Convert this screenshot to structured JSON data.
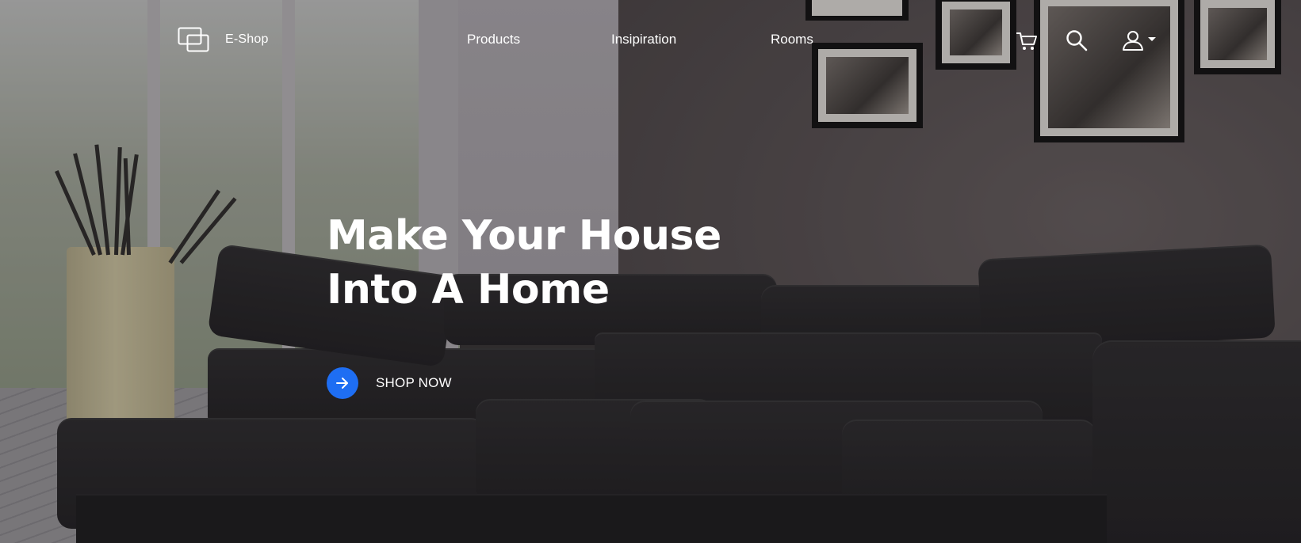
{
  "brand": {
    "name": "E-Shop",
    "logo_icon": "monitor-window-icon"
  },
  "nav": {
    "items": [
      {
        "label": "Products"
      },
      {
        "label": "Insipiration"
      },
      {
        "label": "Rooms"
      }
    ]
  },
  "header_actions": {
    "cart_icon": "cart-icon",
    "search_icon": "search-icon",
    "account_icon": "user-icon",
    "account_dropdown_icon": "caret-down-icon"
  },
  "hero": {
    "title_line_1": "Make Your House",
    "title_line_2": "Into A Home",
    "cta_label": "SHOP NOW",
    "cta_icon": "arrow-right-icon"
  },
  "colors": {
    "accent": "#1e6ef3",
    "text_on_hero": "#ffffff"
  }
}
